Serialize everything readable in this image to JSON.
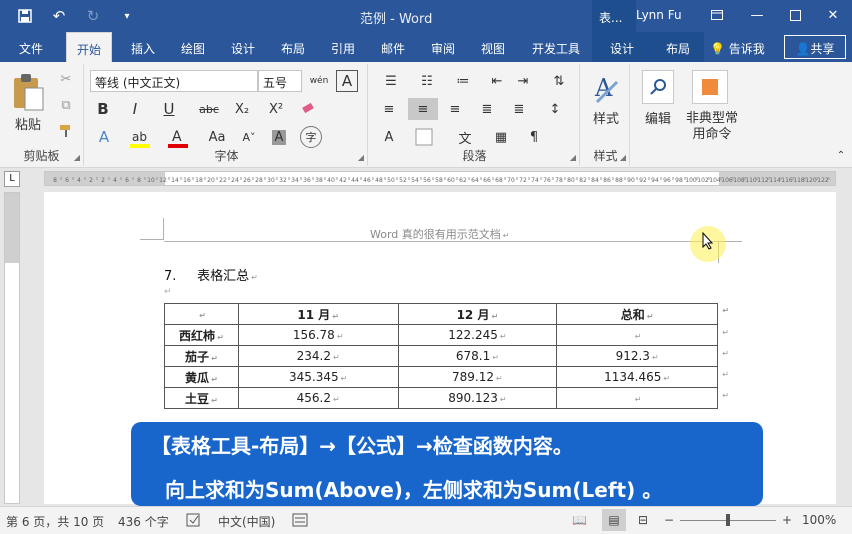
{
  "window": {
    "title": "范例 - Word",
    "context_tab_label": "表...",
    "user_name": "Lynn Fu"
  },
  "tabs": [
    "文件",
    "开始",
    "插入",
    "绘图",
    "设计",
    "布局",
    "引用",
    "邮件",
    "审阅",
    "视图",
    "开发工具",
    "设计",
    "布局"
  ],
  "active_tab": "开始",
  "tell_me": "告诉我",
  "share": "共享",
  "ribbon": {
    "clipboard": {
      "paste": "粘贴",
      "label": "剪贴板"
    },
    "font": {
      "name": "等线 (中文正文)",
      "size": "五号",
      "wen": "wén",
      "bold": "B",
      "italic": "I",
      "underline": "U",
      "strike": "abc",
      "sub": "X₂",
      "sup": "X²",
      "aa": "Aa",
      "char": "字",
      "label": "字体"
    },
    "paragraph": {
      "label": "段落"
    },
    "styles": {
      "button": "样式",
      "label": "样式"
    },
    "editing": {
      "button": "编辑"
    },
    "special": {
      "line1": "非典型常",
      "line2": "用命令"
    }
  },
  "ruler": {
    "top_numbers": [
      "8",
      "6",
      "4",
      "2",
      "2",
      "4",
      "6",
      "8",
      "10",
      "12",
      "14",
      "16",
      "18",
      "20",
      "22",
      "24",
      "26",
      "28",
      "30",
      "32",
      "34",
      "36",
      "38",
      "40",
      "42",
      "44",
      "46",
      "48",
      "50",
      "52",
      "54",
      "56",
      "58",
      "60",
      "62",
      "64",
      "66",
      "68",
      "70",
      "72",
      "74",
      "76",
      "78",
      "80",
      "82",
      "84",
      "86",
      "88",
      "90",
      "92",
      "94",
      "96",
      "98",
      "100",
      "102",
      "104",
      "106",
      "108",
      "110",
      "112",
      "114",
      "116",
      "118",
      "120",
      "122",
      "124",
      "126",
      "128"
    ]
  },
  "document": {
    "header": "Word 真的很有用示范文档",
    "heading_number": "7.",
    "heading_text": "表格汇总",
    "table": {
      "columns": [
        "",
        "11 月",
        "12 月",
        "总和"
      ],
      "rows": [
        [
          "西红柿",
          "156.78",
          "122.245",
          ""
        ],
        [
          "茄子",
          "234.2",
          "678.1",
          "912.3"
        ],
        [
          "黄瓜",
          "345.345",
          "789.12",
          "1134.465"
        ],
        [
          "土豆",
          "456.2",
          "890.123",
          ""
        ]
      ]
    }
  },
  "callout": {
    "line1": "【表格工具-布局】→【公式】→检查函数内容。",
    "line2": "向上求和为Sum(Above)，左侧求和为Sum(Left) 。"
  },
  "status": {
    "page": "第 6 页，共 10 页",
    "words": "436 个字",
    "language": "中文(中国)",
    "zoom": "100%"
  },
  "colors": {
    "brand": "#2b579a",
    "callout": "#1866cc",
    "highlight": "#ffff00",
    "font_red": "#e00000"
  }
}
